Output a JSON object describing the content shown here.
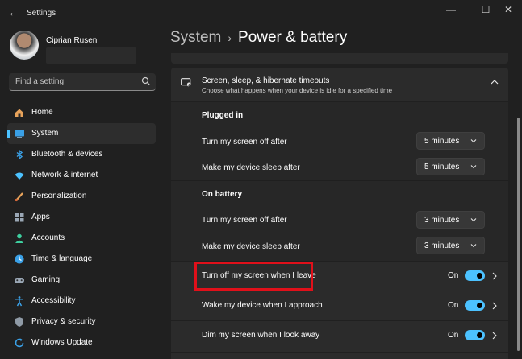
{
  "window": {
    "title": "Settings"
  },
  "user": {
    "name": "Ciprian Rusen"
  },
  "search": {
    "placeholder": "Find a setting"
  },
  "nav": [
    {
      "label": "Home",
      "icon": "home-icon",
      "selected": false
    },
    {
      "label": "System",
      "icon": "system-icon",
      "selected": true
    },
    {
      "label": "Bluetooth & devices",
      "icon": "bluetooth-icon",
      "selected": false
    },
    {
      "label": "Network & internet",
      "icon": "wifi-icon",
      "selected": false
    },
    {
      "label": "Personalization",
      "icon": "brush-icon",
      "selected": false
    },
    {
      "label": "Apps",
      "icon": "apps-icon",
      "selected": false
    },
    {
      "label": "Accounts",
      "icon": "accounts-icon",
      "selected": false
    },
    {
      "label": "Time & language",
      "icon": "globe-clock-icon",
      "selected": false
    },
    {
      "label": "Gaming",
      "icon": "gamepad-icon",
      "selected": false
    },
    {
      "label": "Accessibility",
      "icon": "accessibility-icon",
      "selected": false
    },
    {
      "label": "Privacy & security",
      "icon": "shield-icon",
      "selected": false
    },
    {
      "label": "Windows Update",
      "icon": "update-icon",
      "selected": false
    }
  ],
  "breadcrumb": {
    "parent": "System",
    "separator": "›",
    "current": "Power & battery"
  },
  "section": {
    "title": "Screen, sleep, & hibernate timeouts",
    "description": "Choose what happens when your device is idle for a specified time",
    "plugged_in": {
      "heading": "Plugged in",
      "rows": [
        {
          "label": "Turn my screen off after",
          "value": "5 minutes"
        },
        {
          "label": "Make my device sleep after",
          "value": "5 minutes"
        }
      ]
    },
    "on_battery": {
      "heading": "On battery",
      "rows": [
        {
          "label": "Turn my screen off after",
          "value": "3 minutes"
        },
        {
          "label": "Make my device sleep after",
          "value": "3 minutes"
        }
      ]
    }
  },
  "presence": [
    {
      "label": "Turn off my screen when I leave",
      "state": "On",
      "on": true,
      "highlighted": true
    },
    {
      "label": "Wake my device when I approach",
      "state": "On",
      "on": true,
      "highlighted": false
    },
    {
      "label": "Dim my screen when I look away",
      "state": "On",
      "on": true,
      "highlighted": false
    }
  ],
  "colors": {
    "accent": "#4cc2ff",
    "highlight_box": "#e0101a",
    "background": "#202020",
    "card": "#2b2b2b"
  }
}
